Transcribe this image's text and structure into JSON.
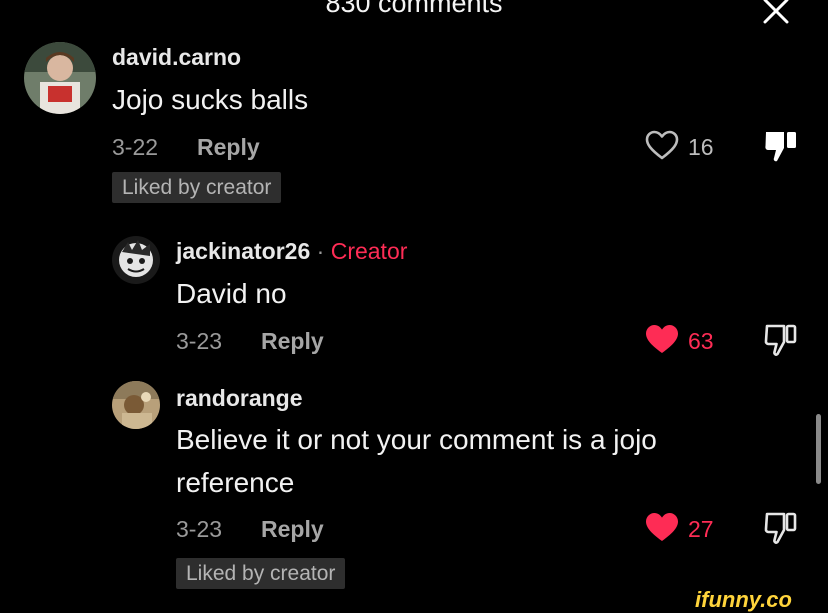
{
  "header": {
    "title": "830 comments"
  },
  "comments": [
    {
      "username": "david.carno",
      "text": "Jojo sucks balls",
      "date": "3-22",
      "reply_label": "Reply",
      "like_count": "16",
      "liked": false,
      "badge": "Liked by creator"
    },
    {
      "username": "jackinator26",
      "separator": "·",
      "creator_label": "Creator",
      "text": "David no",
      "date": "3-23",
      "reply_label": "Reply",
      "like_count": "63",
      "liked": true
    },
    {
      "username": "randorange",
      "text_line1": "Believe it or not your comment is a jojo",
      "text_line2": "reference",
      "date": "3-23",
      "reply_label": "Reply",
      "like_count": "27",
      "liked": true,
      "badge": "Liked by creator"
    }
  ],
  "watermark": "ifunny.co",
  "colors": {
    "background": "#000000",
    "accent": "#fe2c55",
    "text": "#f2f2f2",
    "muted": "#9a9a9a"
  }
}
